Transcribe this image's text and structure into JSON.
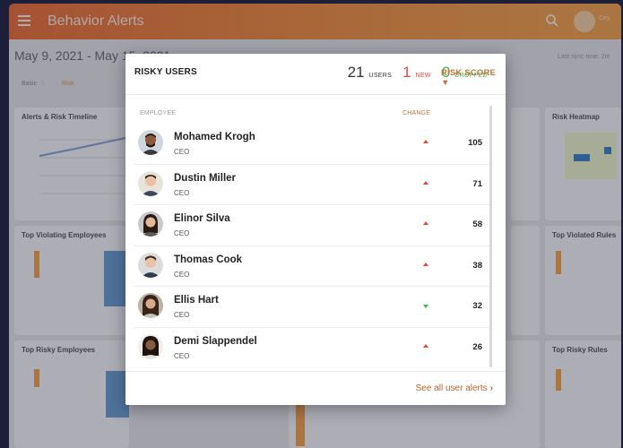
{
  "app": {
    "title": "Behavior Alerts",
    "user_initials": "Cey"
  },
  "toolbar": {
    "date_range": "May 9, 2021 - May 15, 2021",
    "sync": "Last sync time: 2m",
    "view_basic": "Basic",
    "view_risk": "Risk"
  },
  "bg_cards": {
    "timeline": "Alerts & Risk Timeline",
    "heatmap": "Risk Heatmap",
    "violating": "Top Violating Employees",
    "violated_rules": "Top Violated Rules",
    "risky_employees": "Top Risky Employees",
    "risky_rules": "Top Risky Rules"
  },
  "popup": {
    "title": "RISKY USERS",
    "stats": {
      "users_count": "21",
      "users_label": "USERS",
      "new_count": "1",
      "new_label": "NEW",
      "dropped_count": "0",
      "dropped_label": "DROPPED"
    },
    "columns": {
      "employee": "EMPLOYEE",
      "change": "CHANGE",
      "risk_score": "RISK SCORE ▼"
    },
    "users": [
      {
        "name": "Mohamed Krogh",
        "role": "CEO",
        "change": "up",
        "score": "105"
      },
      {
        "name": "Dustin Miller",
        "role": "CEO",
        "change": "up",
        "score": "71"
      },
      {
        "name": "Elinor Silva",
        "role": "CEO",
        "change": "up",
        "score": "58"
      },
      {
        "name": "Thomas Cook",
        "role": "CEO",
        "change": "up",
        "score": "38"
      },
      {
        "name": "Ellis Hart",
        "role": "CEO",
        "change": "down",
        "score": "32"
      },
      {
        "name": "Demi Slappendel",
        "role": "CEO",
        "change": "up",
        "score": "26"
      }
    ],
    "footer_link": "See all user alerts"
  },
  "colors": {
    "accent": "#f08a3c",
    "new": "#e8453c",
    "dropped": "#3cb84a",
    "link": "#b7622c"
  }
}
